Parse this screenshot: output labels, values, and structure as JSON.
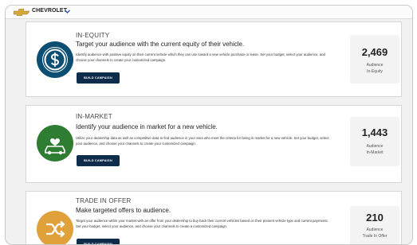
{
  "header": {
    "brand": "CHEVROLET",
    "brand_color": "#d4a93a"
  },
  "campaigns": [
    {
      "title": "IN-EQUITY",
      "subtitle": "Target your audience with the current equity of their vehicle.",
      "description": "Identify audience with positive equity on their current vehicle which they can use toward a new vehicle purchase or lease. Set your budget, select your audience, and choose your channels to create your customized campaign.",
      "button_label": "BUILD CAMPAIGN",
      "count": "2,469",
      "count_label_1": "Audience",
      "count_label_2": "In-Equity",
      "icon": "dollar-coin-icon",
      "icon_color": "#0d4f73"
    },
    {
      "title": "IN-MARKET",
      "subtitle": "Identify your audience in market for a new vehicle.",
      "description": "Utilize your dealership data as well as competitive data to find audience in your area who meet the criteria for being in market for a new vehicle. Set your budget, select your audience, and choose your channels to create your customized campaign.",
      "button_label": "BUILD CAMPAIGN",
      "count": "1,443",
      "count_label_1": "Audience",
      "count_label_2": "In-Market",
      "icon": "car-heart-icon",
      "icon_color": "#2e7d32"
    },
    {
      "title": "TRADE IN OFFER",
      "subtitle": "Make targeted offers to audience.",
      "description": "Target your audience within your market with an offer from your dealership to buy back their current vehicles based on their present vehicle type and current payments. Set your budget, select your audience, and choose your channels to create a customized campaign.",
      "button_label": "BUILD CAMPAIGN",
      "count": "210",
      "count_label_1": "Audience",
      "count_label_2": "Trade In Offer",
      "icon": "shuffle-icon",
      "icon_color": "#e0a13a"
    }
  ]
}
